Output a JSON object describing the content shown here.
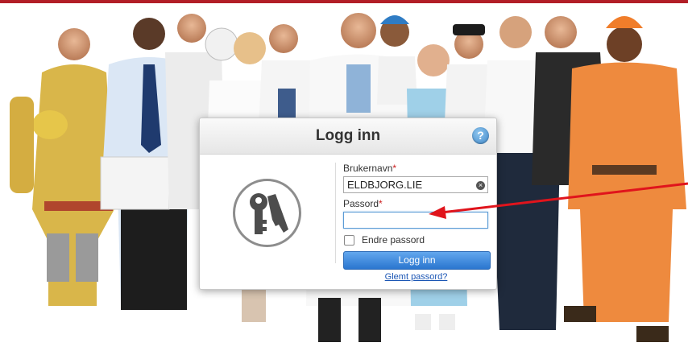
{
  "colors": {
    "brand_bar": "#b21e27",
    "primary_button": "#2a76cf",
    "arrow": "#e0141c",
    "link": "#1a55b4"
  },
  "dialog": {
    "title": "Logg inn",
    "help_icon": "question-circle-icon",
    "key_icon": "keys-icon",
    "username": {
      "label": "Brukernavn",
      "required_mark": "*",
      "value": "ELDBJORG.LIE",
      "clear_icon": "clear-x-icon"
    },
    "password": {
      "label": "Passord",
      "required_mark": "*",
      "value": ""
    },
    "change_password": {
      "label": "Endre passord",
      "checked": false
    },
    "login_button": "Logg inn",
    "forgot_link": "Glemt passord?"
  }
}
